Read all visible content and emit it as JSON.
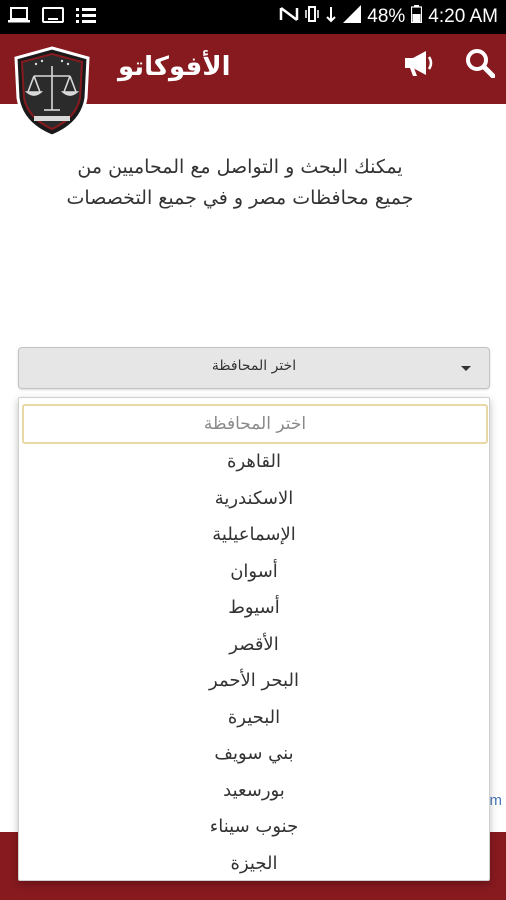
{
  "status_bar": {
    "battery": "48%",
    "time": "4:20 AM",
    "left_icons": [
      "laptop-icon",
      "tablet-icon",
      "dialpad-icon"
    ],
    "right_icons": [
      "nfc-icon",
      "vibrate-icon",
      "wifi-icon",
      "signal-icon",
      "battery-icon"
    ]
  },
  "app_bar": {
    "title": "الأفوكاتو",
    "logo": "scales-shield-logo",
    "actions": [
      "search-icon",
      "megaphone-icon"
    ]
  },
  "intro": {
    "text": "يمكنك البحث و التواصل مع المحاميين من جميع محافظات مصر و في جميع التخصصات"
  },
  "governorate_select": {
    "selected": "اختر المحافظة"
  },
  "dropdown": {
    "search_placeholder": "اختر المحافظة",
    "options": [
      "القاهرة",
      "الاسكندرية",
      "الإسماعيلية",
      "أسوان",
      "أسيوط",
      "الأقصر",
      "البحر الأحمر",
      "البحيرة",
      "بني سويف",
      "بورسعيد",
      "جنوب سيناء",
      "الجيزة"
    ]
  },
  "edge_text": "m",
  "colors": {
    "primary": "#861a1f",
    "status_bar": "#000000",
    "select_bg": "#e6e6e6",
    "search_border": "#e9d8a6"
  }
}
